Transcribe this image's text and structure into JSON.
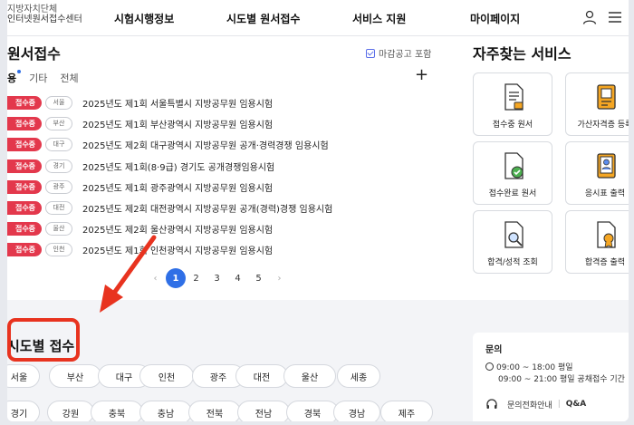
{
  "header": {
    "logo_line1": "지방자치단체",
    "logo_line2": "인터넷원서접수센터",
    "nav": [
      "시험시행정보",
      "시도별 원서접수",
      "서비스 지원",
      "마이페이지"
    ]
  },
  "left": {
    "title": "원서접수",
    "closed_label": "마감공고 포함",
    "tabs": [
      "용",
      "기타",
      "전체"
    ],
    "plus": "+",
    "rows": [
      {
        "status": "접수중",
        "region": "서울",
        "title": "2025년도 제1회 서울특별시 지방공무원 임용시험"
      },
      {
        "status": "접수중",
        "region": "부산",
        "title": "2025년도 제1회 부산광역시 지방공무원 임용시험"
      },
      {
        "status": "접수중",
        "region": "대구",
        "title": "2025년도 제2회 대구광역시 지방공무원 공개·경력경쟁 임용시험"
      },
      {
        "status": "접수중",
        "region": "경기",
        "title": "2025년도 제1회(8·9급) 경기도 공개경쟁임용시험"
      },
      {
        "status": "접수중",
        "region": "광주",
        "title": "2025년도 제1회 광주광역시 지방공무원 임용시험"
      },
      {
        "status": "접수중",
        "region": "대전",
        "title": "2025년도 제2회 대전광역시 지방공무원 공개(경력)경쟁 임용시험"
      },
      {
        "status": "접수중",
        "region": "울산",
        "title": "2025년도 제2회 울산광역시 지방공무원 임용시험"
      },
      {
        "status": "접수중",
        "region": "인천",
        "title": "2025년도 제1회 인천광역시 지방공무원 임용시험"
      }
    ],
    "pager": {
      "prev": "‹",
      "pages": [
        "1",
        "2",
        "3",
        "4",
        "5"
      ],
      "next": "›",
      "current": "1"
    }
  },
  "services": {
    "title": "자주찾는 서비스",
    "cards": [
      "접수중 원서",
      "가산자격증 등록",
      "접수완료 원서",
      "응시표 출력",
      "합격/성적 조회",
      "합격증 출력"
    ]
  },
  "sido": {
    "title": "시도별 접수",
    "row1": [
      "서울",
      "부산",
      "대구",
      "인천",
      "광주",
      "대전",
      "울산",
      "세종"
    ],
    "row2": [
      "경기",
      "강원",
      "충북",
      "충남",
      "전북",
      "전남",
      "경북",
      "경남",
      "제주"
    ]
  },
  "inquiry": {
    "title": "문의",
    "hours1": "09:00 ~ 18:00 평일",
    "hours2": "09:00 ~ 21:00 평일 공채접수 기간",
    "phone": "문의전화안내",
    "qa": "Q&A"
  },
  "colors": {
    "accent": "#2f6fe6",
    "status": "#e3384c",
    "annotation": "#e8331f"
  }
}
